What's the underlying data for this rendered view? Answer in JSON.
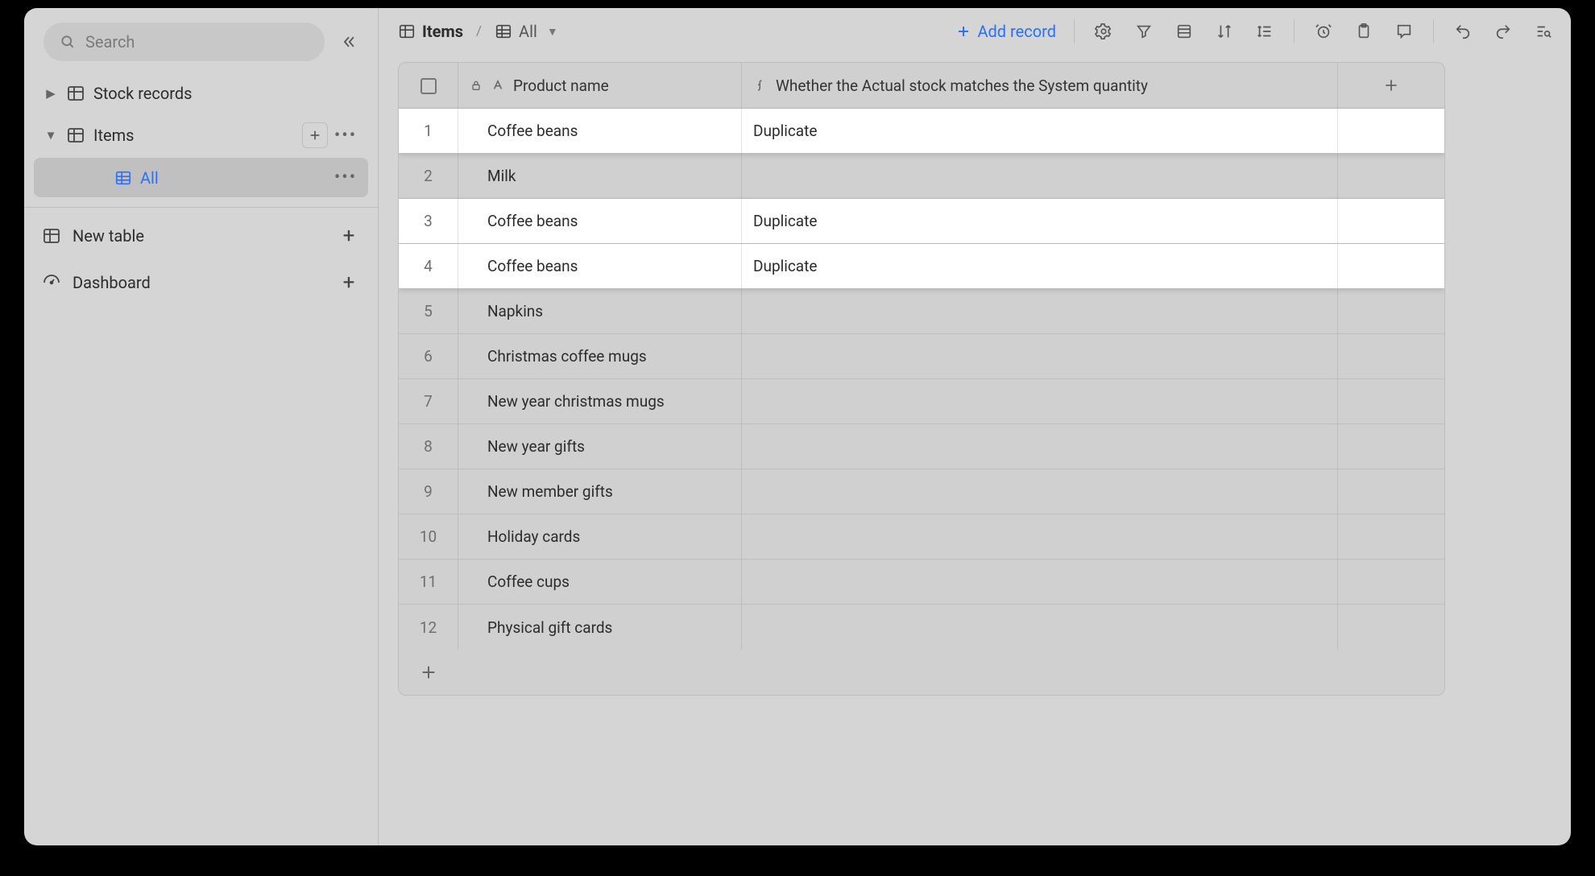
{
  "sidebar": {
    "search_placeholder": "Search",
    "nodes": {
      "stock_records": "Stock records",
      "items": "Items",
      "views": {
        "all": "All"
      }
    },
    "new_table": "New table",
    "dashboard": "Dashboard"
  },
  "toolbar": {
    "crumb_table": "Items",
    "crumb_view": "All",
    "add_record": "Add record"
  },
  "grid": {
    "columns": {
      "product_name": "Product name",
      "stock_match": "Whether the Actual stock matches the System quantity"
    },
    "rows": [
      {
        "n": "1",
        "product": "Coffee beans",
        "match": "Duplicate",
        "highlight": true
      },
      {
        "n": "2",
        "product": "Milk",
        "match": "",
        "highlight": false
      },
      {
        "n": "3",
        "product": "Coffee beans",
        "match": "Duplicate",
        "highlight": true
      },
      {
        "n": "4",
        "product": "Coffee beans",
        "match": "Duplicate",
        "highlight": true
      },
      {
        "n": "5",
        "product": "Napkins",
        "match": "",
        "highlight": false
      },
      {
        "n": "6",
        "product": "Christmas coffee mugs",
        "match": "",
        "highlight": false
      },
      {
        "n": "7",
        "product": "New year christmas mugs",
        "match": "",
        "highlight": false
      },
      {
        "n": "8",
        "product": "New year gifts",
        "match": "",
        "highlight": false
      },
      {
        "n": "9",
        "product": "New member gifts",
        "match": "",
        "highlight": false
      },
      {
        "n": "10",
        "product": "Holiday cards",
        "match": "",
        "highlight": false
      },
      {
        "n": "11",
        "product": "Coffee cups",
        "match": "",
        "highlight": false
      },
      {
        "n": "12",
        "product": "Physical gift cards",
        "match": "",
        "highlight": false
      }
    ]
  }
}
